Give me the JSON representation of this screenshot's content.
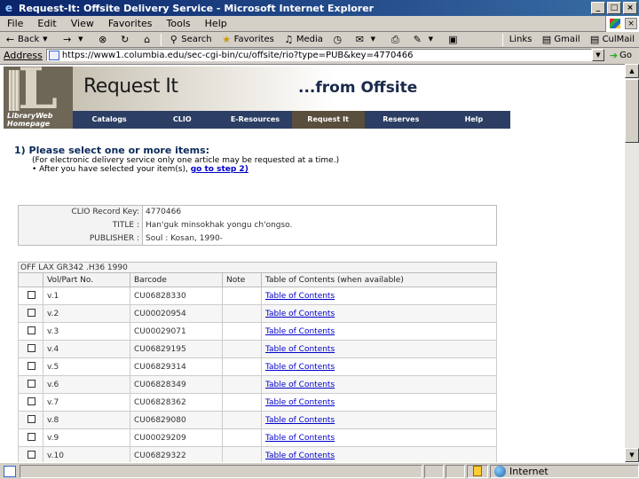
{
  "window": {
    "title": "Request-It: Offsite Delivery Service - Microsoft Internet Explorer"
  },
  "menu": [
    "File",
    "Edit",
    "View",
    "Favorites",
    "Tools",
    "Help"
  ],
  "toolbar": {
    "back": "Back",
    "search": "Search",
    "favorites": "Favorites",
    "media": "Media",
    "links": "Links",
    "gmail": "Gmail",
    "culmail": "CulMail"
  },
  "address": {
    "label": "Address",
    "url": "https://www1.columbia.edu/sec-cgi-bin/cu/offsite/rio?type=PUB&key=4770466",
    "go": "Go"
  },
  "banner": {
    "logo_caption_1": "LibraryWeb",
    "logo_caption_2": "Homepage",
    "request_it": "Request It",
    "from_offsite": "...from Offsite",
    "nav": [
      "Catalogs",
      "CLIO",
      "E-Resources",
      "Request It",
      "Reserves",
      "Help"
    ]
  },
  "step": {
    "heading": "1) Please select one or more items:",
    "note": "(For electronic delivery service only one article may be requested at a time.)",
    "after_prefix": "• After you have selected your item(s),",
    "step2_link": "go to step 2)"
  },
  "record": {
    "rows": [
      {
        "key": "CLIO Record Key:",
        "value": "4770466"
      },
      {
        "key": "TITLE :",
        "value": "Han'guk minsokhak yongu ch'ongso."
      },
      {
        "key": "PUBLISHER :",
        "value": "Soul : Kosan, 1990-"
      }
    ]
  },
  "items": {
    "call_number": "OFF LAX    GR342 .H36 1990",
    "headers": [
      "",
      "Vol/Part No.",
      "Barcode",
      "Note",
      "Table of Contents (when available)"
    ],
    "toc_label": "Table of Contents",
    "rows": [
      {
        "vol": "v.1",
        "barcode": "CU06828330"
      },
      {
        "vol": "v.2",
        "barcode": "CU00020954"
      },
      {
        "vol": "v.3",
        "barcode": "CU00029071"
      },
      {
        "vol": "v.4",
        "barcode": "CU06829195"
      },
      {
        "vol": "v.5",
        "barcode": "CU06829314"
      },
      {
        "vol": "v.6",
        "barcode": "CU06828349"
      },
      {
        "vol": "v.7",
        "barcode": "CU06828362"
      },
      {
        "vol": "v.8",
        "barcode": "CU06829080"
      },
      {
        "vol": "v.9",
        "barcode": "CU00029209"
      },
      {
        "vol": "v.10",
        "barcode": "CU06829322"
      }
    ]
  },
  "status": {
    "zone": "Internet"
  }
}
